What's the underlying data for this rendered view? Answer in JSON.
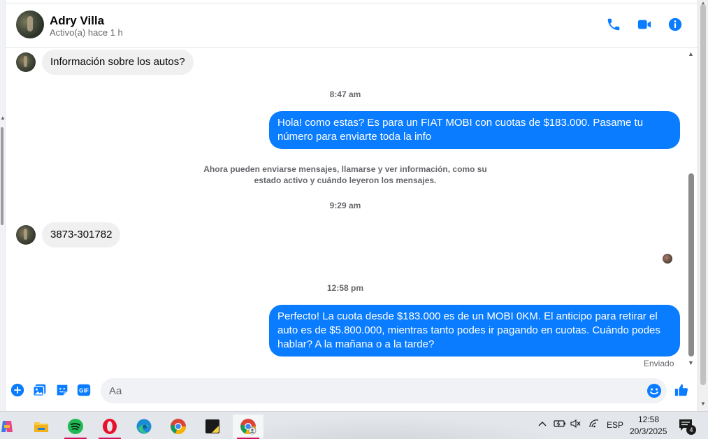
{
  "conversation": {
    "contact_name": "Adry Villa",
    "contact_status": "Activo(a) hace 1 h"
  },
  "header_actions": {
    "call_icon": "phone-icon",
    "video_icon": "video-camera-icon",
    "info_icon": "info-icon"
  },
  "messages": {
    "incoming_1": "Información sobre los autos?",
    "time_1": "8:47 am",
    "outgoing_1": "Hola! como estas? Es para un FIAT MOBI con cuotas de $183.000. Pasame tu número para enviarte toda la info",
    "notice": "Ahora pueden enviarse mensajes, llamarse y ver información, como su estado activo y cuándo leyeron los mensajes.",
    "time_2": "9:29 am",
    "incoming_2": "3873-301782",
    "time_3": "12:58 pm",
    "outgoing_2": "Perfecto! La cuota desde $183.000 es de un MOBI 0KM. El anticipo para retirar el auto es de $5.800.000, mientras tanto podes ir pagando en cuotas. Cuándo podes hablar? A la mañana o a la tarde?",
    "delivery_status": "Enviado"
  },
  "composer": {
    "placeholder": "Aa",
    "value": "",
    "gif_label": "GIF"
  },
  "taskbar": {
    "language": "ESP",
    "time": "12:58",
    "date": "20/3/2025",
    "notification_count": "4"
  },
  "colors": {
    "messenger_blue": "#0a7cff",
    "incoming_bubble": "#f0f0f0",
    "secondary_text": "#65676b"
  }
}
